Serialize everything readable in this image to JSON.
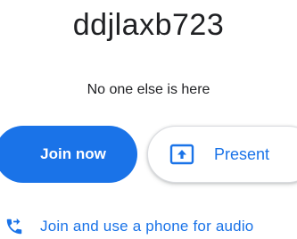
{
  "meeting": {
    "code": "ddjlaxb723",
    "status": "No one else is here"
  },
  "actions": {
    "join_label": "Join now",
    "present_label": "Present",
    "phone_label": "Join and use a phone for audio"
  },
  "icons": {
    "present": "present-to-all-icon",
    "phone": "phone-forwarded-icon"
  },
  "colors": {
    "accent": "#1a73e8",
    "text": "#202124",
    "border": "#dadce0"
  }
}
